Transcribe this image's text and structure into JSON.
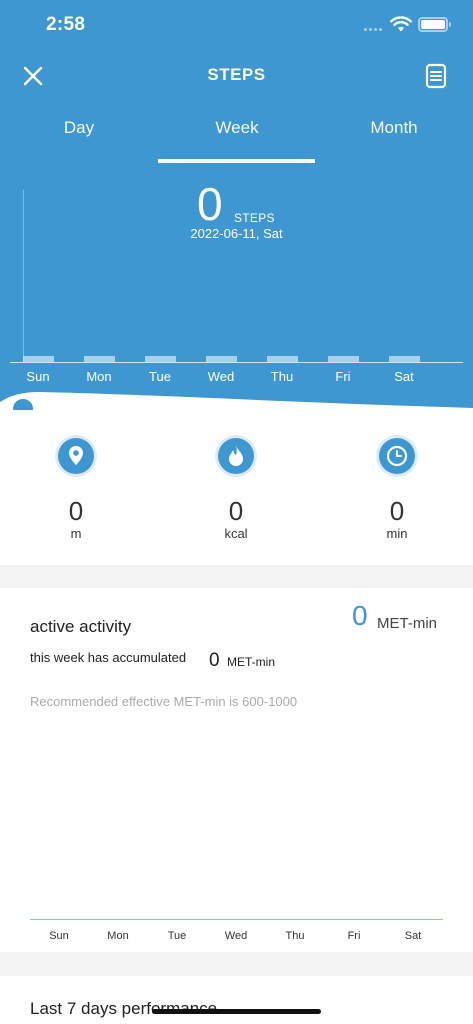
{
  "status_bar": {
    "time": "2:58"
  },
  "nav": {
    "title": "STEPS"
  },
  "tabs": [
    {
      "label": "Day",
      "selected": false
    },
    {
      "label": "Week",
      "selected": true
    },
    {
      "label": "Month",
      "selected": false
    }
  ],
  "summary": {
    "value": "0",
    "unit": "STEPS",
    "date": "2022-06-11, Sat"
  },
  "chart_data": {
    "type": "bar",
    "categories": [
      "Sun",
      "Mon",
      "Tue",
      "Wed",
      "Thu",
      "Fri",
      "Sat"
    ],
    "values": [
      0,
      0,
      0,
      0,
      0,
      0,
      0
    ]
  },
  "stats": [
    {
      "icon": "location-pin-icon",
      "value": "0",
      "unit": "m"
    },
    {
      "icon": "flame-icon",
      "value": "0",
      "unit": "kcal"
    },
    {
      "icon": "clock-icon",
      "value": "0",
      "unit": "min"
    }
  ],
  "activity": {
    "title": "active activity",
    "total": "0",
    "total_unit": "MET-min",
    "week_text": "this week has accumulated",
    "week_value": "0",
    "week_unit": "MET-min",
    "recommendation": "Recommended effective MET-min is 600-1000",
    "days": [
      "Sun",
      "Mon",
      "Tue",
      "Wed",
      "Thu",
      "Fri",
      "Sat"
    ]
  },
  "last7": {
    "title": "Last 7 days performance"
  },
  "colors": {
    "accent": "#3e97d0"
  }
}
